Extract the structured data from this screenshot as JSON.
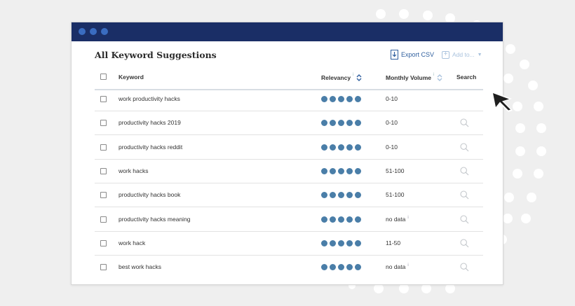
{
  "window": {
    "titlebar_color": "#1a2e66"
  },
  "heading": "All Keyword Suggestions",
  "actions": {
    "export_label": "Export CSV",
    "add_to_label": "Add to..."
  },
  "columns": {
    "keyword": "Keyword",
    "relevancy": "Relevancy",
    "relevancy_info": "i",
    "monthly_volume": "Monthly Volume",
    "volume_info": "i",
    "search": "Search"
  },
  "rows": [
    {
      "keyword": "work productivity hacks",
      "relevancy": 5,
      "volume": "0-10",
      "volume_info": "",
      "search_icon": false
    },
    {
      "keyword": "productivity hacks 2019",
      "relevancy": 5,
      "volume": "0-10",
      "volume_info": "",
      "search_icon": true
    },
    {
      "keyword": "productivity hacks reddit",
      "relevancy": 5,
      "volume": "0-10",
      "volume_info": "",
      "search_icon": true
    },
    {
      "keyword": "work hacks",
      "relevancy": 5,
      "volume": "51-100",
      "volume_info": "",
      "search_icon": true
    },
    {
      "keyword": "productivity hacks book",
      "relevancy": 5,
      "volume": "51-100",
      "volume_info": "",
      "search_icon": true
    },
    {
      "keyword": "productivity hacks meaning",
      "relevancy": 5,
      "volume": "no data",
      "volume_info": "i",
      "search_icon": true
    },
    {
      "keyword": "work hack",
      "relevancy": 5,
      "volume": "11-50",
      "volume_info": "",
      "search_icon": true
    },
    {
      "keyword": "best work hacks",
      "relevancy": 5,
      "volume": "no data",
      "volume_info": "i",
      "search_icon": true
    }
  ],
  "colors": {
    "accent": "#2f5f9e",
    "relevancy_dot": "#4a7ea8",
    "background": "#efefef"
  },
  "icons": {
    "export": "download-icon",
    "add": "plus-icon",
    "search": "search-icon",
    "cursor": "mouse-cursor-icon"
  }
}
